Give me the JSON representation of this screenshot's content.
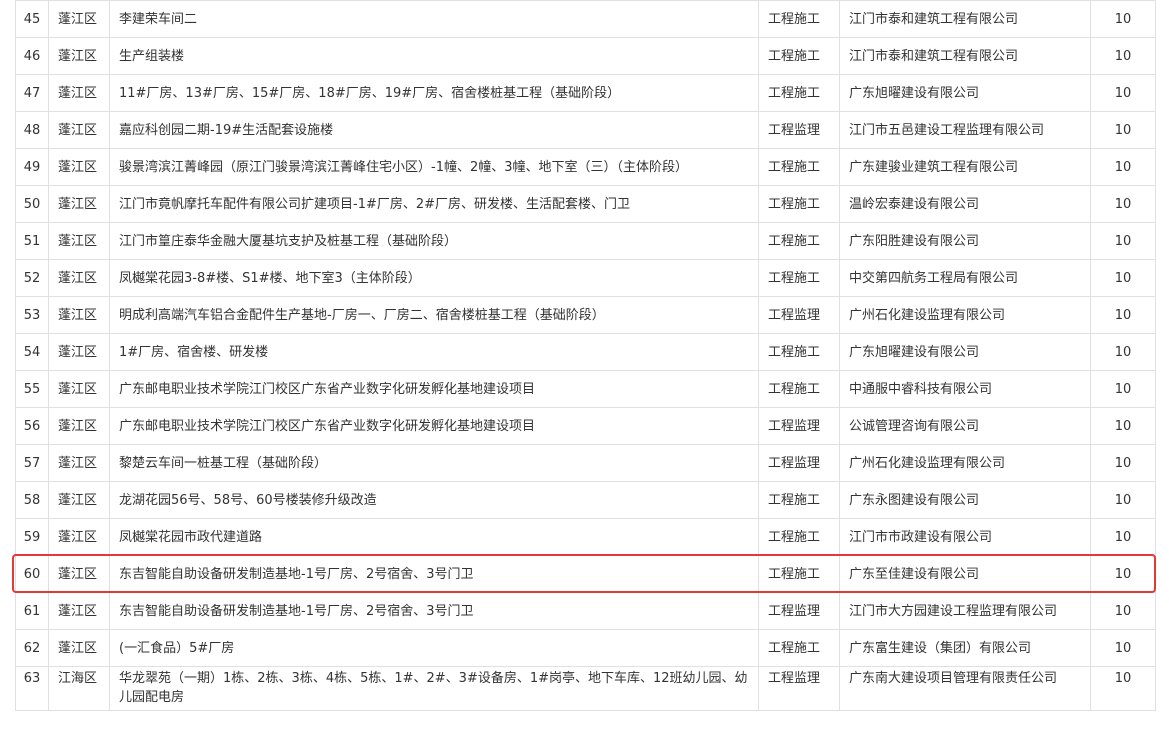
{
  "highlight_color": "#e53935",
  "rows": [
    {
      "no": "45",
      "district": "蓬江区",
      "name": "李建荣车间二",
      "type": "工程施工",
      "company": "江门市泰和建筑工程有限公司",
      "score": "10"
    },
    {
      "no": "46",
      "district": "蓬江区",
      "name": "生产组装楼",
      "type": "工程施工",
      "company": "江门市泰和建筑工程有限公司",
      "score": "10"
    },
    {
      "no": "47",
      "district": "蓬江区",
      "name": "11#厂房、13#厂房、15#厂房、18#厂房、19#厂房、宿舍楼桩基工程（基础阶段）",
      "type": "工程施工",
      "company": "广东旭曜建设有限公司",
      "score": "10"
    },
    {
      "no": "48",
      "district": "蓬江区",
      "name": "嘉应科创园二期-19#生活配套设施楼",
      "type": "工程监理",
      "company": "江门市五邑建设工程监理有限公司",
      "score": "10"
    },
    {
      "no": "49",
      "district": "蓬江区",
      "name": "骏景湾滨江菁峰园（原江门骏景湾滨江菁峰住宅小区）-1幢、2幢、3幢、地下室（三）（主体阶段）",
      "type": "工程施工",
      "company": "广东建骏业建筑工程有限公司",
      "score": "10"
    },
    {
      "no": "50",
      "district": "蓬江区",
      "name": "江门市竟帆摩托车配件有限公司扩建项目-1#厂房、2#厂房、研发楼、生活配套楼、门卫",
      "type": "工程施工",
      "company": "温岭宏泰建设有限公司",
      "score": "10"
    },
    {
      "no": "51",
      "district": "蓬江区",
      "name": "江门市篁庄泰华金融大厦基坑支护及桩基工程（基础阶段）",
      "type": "工程施工",
      "company": "广东阳胜建设有限公司",
      "score": "10"
    },
    {
      "no": "52",
      "district": "蓬江区",
      "name": "凤樾棠花园3-8#楼、S1#楼、地下室3（主体阶段）",
      "type": "工程施工",
      "company": "中交第四航务工程局有限公司",
      "score": "10"
    },
    {
      "no": "53",
      "district": "蓬江区",
      "name": "明成利高端汽车铝合金配件生产基地-厂房一、厂房二、宿舍楼桩基工程（基础阶段）",
      "type": "工程监理",
      "company": "广州石化建设监理有限公司",
      "score": "10"
    },
    {
      "no": "54",
      "district": "蓬江区",
      "name": "1#厂房、宿舍楼、研发楼",
      "type": "工程施工",
      "company": "广东旭曜建设有限公司",
      "score": "10"
    },
    {
      "no": "55",
      "district": "蓬江区",
      "name": "广东邮电职业技术学院江门校区广东省产业数字化研发孵化基地建设项目",
      "type": "工程施工",
      "company": "中通服中睿科技有限公司",
      "score": "10"
    },
    {
      "no": "56",
      "district": "蓬江区",
      "name": "广东邮电职业技术学院江门校区广东省产业数字化研发孵化基地建设项目",
      "type": "工程监理",
      "company": "公诚管理咨询有限公司",
      "score": "10"
    },
    {
      "no": "57",
      "district": "蓬江区",
      "name": "黎楚云车间一桩基工程（基础阶段）",
      "type": "工程监理",
      "company": "广州石化建设监理有限公司",
      "score": "10"
    },
    {
      "no": "58",
      "district": "蓬江区",
      "name": "龙湖花园56号、58号、60号楼装修升级改造",
      "type": "工程施工",
      "company": "广东永图建设有限公司",
      "score": "10"
    },
    {
      "no": "59",
      "district": "蓬江区",
      "name": "凤樾棠花园市政代建道路",
      "type": "工程施工",
      "company": "江门市市政建设有限公司",
      "score": "10"
    },
    {
      "no": "60",
      "district": "蓬江区",
      "name": "东吉智能自助设备研发制造基地-1号厂房、2号宿舍、3号门卫",
      "type": "工程施工",
      "company": "广东至佳建设有限公司",
      "score": "10"
    },
    {
      "no": "61",
      "district": "蓬江区",
      "name": "东吉智能自助设备研发制造基地-1号厂房、2号宿舍、3号门卫",
      "type": "工程监理",
      "company": "江门市大方园建设工程监理有限公司",
      "score": "10"
    },
    {
      "no": "62",
      "district": "蓬江区",
      "name": "(一汇食品）5#厂房",
      "type": "工程施工",
      "company": "广东富生建设（集团）有限公司",
      "score": "10"
    },
    {
      "no": "63",
      "district": "江海区",
      "name": "华龙翠苑（一期）1栋、2栋、3栋、4栋、5栋、1#、2#、3#设备房、1#岗亭、地下车库、12班幼儿园、幼儿园配电房",
      "type": "工程监理",
      "company": "广东南大建设项目管理有限责任公司",
      "score": "10"
    }
  ]
}
